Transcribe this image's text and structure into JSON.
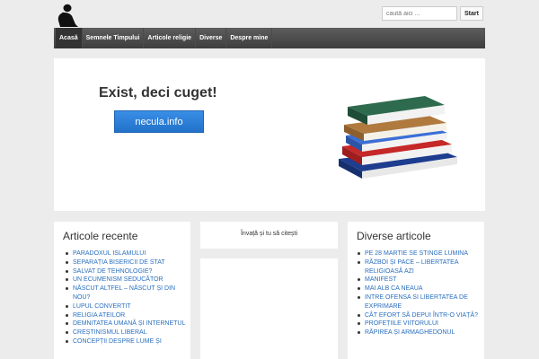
{
  "header": {
    "search_placeholder": "caută aici ...",
    "search_button": "Start"
  },
  "nav": {
    "items": [
      {
        "label": "Acasă"
      },
      {
        "label": "Semnele Timpului"
      },
      {
        "label": "Articole religie"
      },
      {
        "label": "Diverse"
      },
      {
        "label": "Despre mine"
      }
    ]
  },
  "hero": {
    "title": "Exist, deci cuget!",
    "button_label": "necula.info"
  },
  "recent": {
    "title": "Articole recente",
    "items": [
      "PARADOXUL ISLAMULUI",
      "SEPARAȚIA BISERICII DE STAT",
      "SALVAT DE TEHNOLOGIE?",
      "UN ECUMENISM SEDUCĂTOR",
      "NĂSCUT ALTFEL – NĂSCUT ȘI DIN NOU?",
      "LUPUL CONVERTIT",
      "RELIGIA ATEILOR",
      "DEMNITATEA UMANĂ ȘI INTERNETUL",
      "CREȘTINISMUL LIBERAL",
      "CONCEPȚII DESPRE LUME ȘI"
    ]
  },
  "middle": {
    "text": "Învață și tu să citești"
  },
  "diverse": {
    "title": "Diverse articole",
    "items": [
      "PE 28 MARTIE SE STINGE LUMINA",
      "RĂZBOI ȘI PACE – LIBERTATEA RELIGIOASĂ AZI",
      "MANIFEST",
      "MAI ALB CA NEAUA",
      "INTRE OFENSA SI LIBERTATEA DE EXPRIMARE",
      "CÂT EFORT SĂ DEPUI ÎNTR-O VIAȚĂ?",
      "PROFEȚIILE VIITORULUI",
      "RĂPIREA ȘI ARMAGHEDONUL"
    ]
  }
}
